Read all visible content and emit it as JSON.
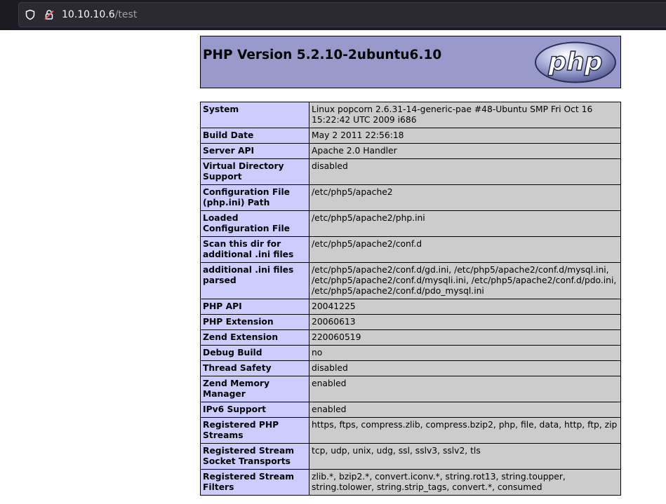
{
  "browser": {
    "url_host": "10.10.10.6",
    "url_path": "/test"
  },
  "header": {
    "title": "PHP Version 5.2.10-2ubuntu6.10",
    "logo_text": "php"
  },
  "rows": [
    {
      "key": "System",
      "value": "Linux popcorn 2.6.31-14-generic-pae #48-Ubuntu SMP Fri Oct 16 15:22:42 UTC 2009 i686"
    },
    {
      "key": "Build Date",
      "value": "May 2 2011 22:56:18"
    },
    {
      "key": "Server API",
      "value": "Apache 2.0 Handler"
    },
    {
      "key": "Virtual Directory Support",
      "value": "disabled"
    },
    {
      "key": "Configuration File (php.ini) Path",
      "value": "/etc/php5/apache2"
    },
    {
      "key": "Loaded Configuration File",
      "value": "/etc/php5/apache2/php.ini"
    },
    {
      "key": "Scan this dir for additional .ini files",
      "value": "/etc/php5/apache2/conf.d"
    },
    {
      "key": "additional .ini files parsed",
      "value": "/etc/php5/apache2/conf.d/gd.ini, /etc/php5/apache2/conf.d/mysql.ini, /etc/php5/apache2/conf.d/mysqli.ini, /etc/php5/apache2/conf.d/pdo.ini, /etc/php5/apache2/conf.d/pdo_mysql.ini"
    },
    {
      "key": "PHP API",
      "value": "20041225"
    },
    {
      "key": "PHP Extension",
      "value": "20060613"
    },
    {
      "key": "Zend Extension",
      "value": "220060519"
    },
    {
      "key": "Debug Build",
      "value": "no"
    },
    {
      "key": "Thread Safety",
      "value": "disabled"
    },
    {
      "key": "Zend Memory Manager",
      "value": "enabled"
    },
    {
      "key": "IPv6 Support",
      "value": "enabled"
    },
    {
      "key": "Registered PHP Streams",
      "value": "https, ftps, compress.zlib, compress.bzip2, php, file, data, http, ftp, zip"
    },
    {
      "key": "Registered Stream Socket Transports",
      "value": "tcp, udp, unix, udg, ssl, sslv3, sslv2, tls"
    },
    {
      "key": "Registered Stream Filters",
      "value": "zlib.*, bzip2.*, convert.iconv.*, string.rot13, string.toupper, string.tolower, string.strip_tags, convert.*, consumed"
    }
  ],
  "colors": {
    "header_bg": "#9999cc",
    "key_bg": "#ccccff",
    "value_bg": "#cccccc",
    "toolbar_bg": "#1c1b22"
  },
  "icons": [
    "shield-icon",
    "insecure-lock-icon",
    "php-logo"
  ]
}
